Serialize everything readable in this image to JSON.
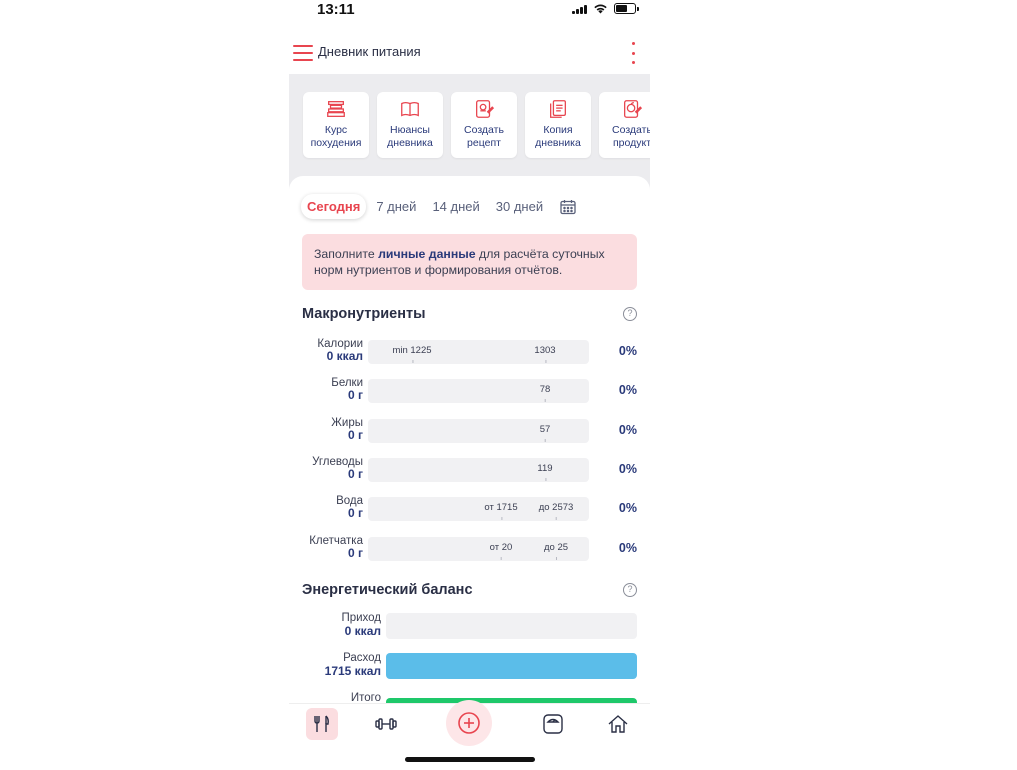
{
  "status_bar": {
    "time": "13:11"
  },
  "header": {
    "title": "Дневник питания"
  },
  "shortcuts": [
    {
      "label": "Курс\nпохудения",
      "icon": "course-icon"
    },
    {
      "label": "Нюансы\nдневника",
      "icon": "book-icon"
    },
    {
      "label": "Создать\nрецепт",
      "icon": "recipe-icon"
    },
    {
      "label": "Копия\nдневника",
      "icon": "copy-diary-icon"
    },
    {
      "label": "Создать\nпродукт",
      "icon": "product-icon"
    }
  ],
  "period_tabs": [
    "Сегодня",
    "7 дней",
    "14 дней",
    "30 дней"
  ],
  "notice": {
    "before": "Заполните ",
    "link": "личные данные",
    "after": " для расчёта суточных норм нутриентов и формирования отчётов."
  },
  "macros": {
    "title": "Макронутриенты",
    "rows": [
      {
        "name": "Калории",
        "value": "0 ккал",
        "markers": [
          {
            "text": "min 1225",
            "pos": 0.2
          },
          {
            "text": "1303",
            "pos": 0.8
          }
        ],
        "percent": "0%"
      },
      {
        "name": "Белки",
        "value": "0 г",
        "markers": [
          {
            "text": "78",
            "pos": 0.8
          }
        ],
        "percent": "0%"
      },
      {
        "name": "Жиры",
        "value": "0 г",
        "markers": [
          {
            "text": "57",
            "pos": 0.8
          }
        ],
        "percent": "0%"
      },
      {
        "name": "Углеводы",
        "value": "0 г",
        "markers": [
          {
            "text": "119",
            "pos": 0.8
          }
        ],
        "percent": "0%"
      },
      {
        "name": "Вода",
        "value": "0 г",
        "markers": [
          {
            "text": "от 1715",
            "pos": 0.6
          },
          {
            "text": "до 2573",
            "pos": 0.85
          }
        ],
        "percent": "0%"
      },
      {
        "name": "Клетчатка",
        "value": "0 г",
        "markers": [
          {
            "text": "от 20",
            "pos": 0.6
          },
          {
            "text": "до 25",
            "pos": 0.85
          }
        ],
        "percent": "0%"
      }
    ]
  },
  "balance": {
    "title": "Энергетический баланс",
    "rows": [
      {
        "name": "Приход",
        "value": "0 ккал",
        "color": "#f1f1f3"
      },
      {
        "name": "Расход",
        "value": "1715 ккал",
        "color": "#5bbde9"
      },
      {
        "name": "Итого",
        "value": "",
        "color": "#1ec86a"
      }
    ]
  },
  "nav": [
    "fork-knife-icon",
    "dumbbell-icon",
    "add-icon",
    "scale-icon",
    "home-icon"
  ],
  "colors": {
    "accent": "#e8454f",
    "link": "#2a3a7a",
    "notice_bg": "#fbdde0"
  }
}
